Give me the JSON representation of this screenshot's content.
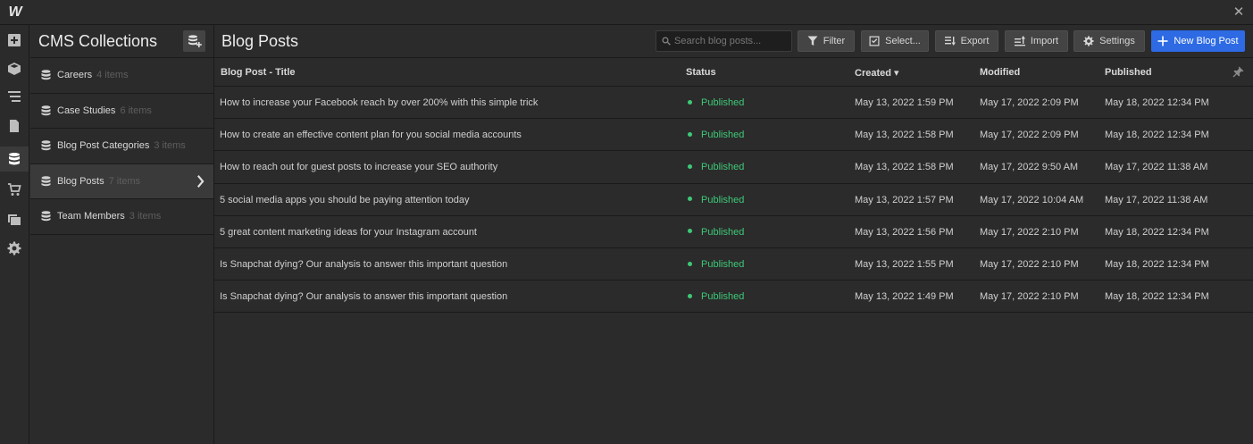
{
  "app": {
    "logo_text": "W",
    "close_glyph": "✕"
  },
  "colors": {
    "accent": "#2d6ae3",
    "status_published": "#3ec877",
    "background": "#2b2b2b"
  },
  "leftbar": {
    "icons": [
      "add-panel-icon",
      "cube-icon",
      "navigator-icon",
      "page-icon",
      "cms-database-icon",
      "ecommerce-cart-icon",
      "assets-icon",
      "settings-gear-icon"
    ],
    "active": "cms-database-icon"
  },
  "collections": {
    "title": "CMS Collections",
    "items": [
      {
        "label": "Careers",
        "count": "4 items",
        "active": false
      },
      {
        "label": "Case Studies",
        "count": "6 items",
        "active": false
      },
      {
        "label": "Blog Post Categories",
        "count": "3 items",
        "active": false
      },
      {
        "label": "Blog Posts",
        "count": "7 items",
        "active": true
      },
      {
        "label": "Team Members",
        "count": "3 items",
        "active": false
      }
    ]
  },
  "main": {
    "title": "Blog Posts",
    "search_placeholder": "Search blog posts...",
    "buttons": {
      "filter": "Filter",
      "select": "Select...",
      "export": "Export",
      "import": "Import",
      "settings": "Settings",
      "new": "New Blog Post"
    },
    "columns": {
      "title": "Blog Post - Title",
      "status": "Status",
      "created": "Created ▾",
      "modified": "Modified",
      "published": "Published"
    },
    "rows": [
      {
        "title": "How to increase your Facebook reach by over 200% with this simple trick",
        "status": "Published",
        "created": "May 13, 2022 1:59 PM",
        "modified": "May 17, 2022 2:09 PM",
        "published": "May 18, 2022 12:34 PM"
      },
      {
        "title": "How to create an effective content plan for you social media accounts",
        "status": "Published",
        "created": "May 13, 2022 1:58 PM",
        "modified": "May 17, 2022 2:09 PM",
        "published": "May 18, 2022 12:34 PM"
      },
      {
        "title": "How to reach out for guest posts to increase your SEO authority",
        "status": "Published",
        "created": "May 13, 2022 1:58 PM",
        "modified": "May 17, 2022 9:50 AM",
        "published": "May 17, 2022 11:38 AM"
      },
      {
        "title": "5 social media apps you should be paying attention today",
        "status": "Published",
        "created": "May 13, 2022 1:57 PM",
        "modified": "May 17, 2022 10:04 AM",
        "published": "May 17, 2022 11:38 AM"
      },
      {
        "title": "5 great content marketing ideas for your Instagram account",
        "status": "Published",
        "created": "May 13, 2022 1:56 PM",
        "modified": "May 17, 2022 2:10 PM",
        "published": "May 18, 2022 12:34 PM"
      },
      {
        "title": "Is Snapchat dying? Our analysis to answer this important question",
        "status": "Published",
        "created": "May 13, 2022 1:55 PM",
        "modified": "May 17, 2022 2:10 PM",
        "published": "May 18, 2022 12:34 PM"
      },
      {
        "title": "Is Snapchat dying? Our analysis to answer this important question",
        "status": "Published",
        "created": "May 13, 2022 1:49 PM",
        "modified": "May 17, 2022 2:10 PM",
        "published": "May 18, 2022 12:34 PM"
      }
    ]
  }
}
